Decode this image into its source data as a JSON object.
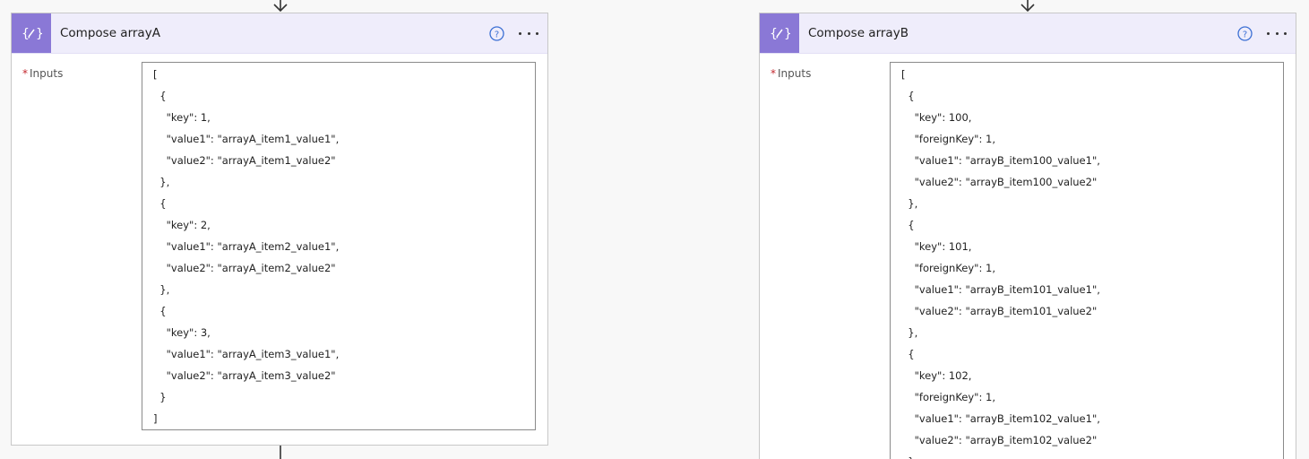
{
  "cardA": {
    "title": "Compose arrayA",
    "icon": "compose-icon",
    "input_label": "Inputs",
    "required_marker": "*",
    "lines": [
      "[",
      "  {",
      "    \"key\": 1,",
      "    \"value1\": \"arrayA_item1_value1\",",
      "    \"value2\": \"arrayA_item1_value2\"",
      "  },",
      "  {",
      "    \"key\": 2,",
      "    \"value1\": \"arrayA_item2_value1\",",
      "    \"value2\": \"arrayA_item2_value2\"",
      "  },",
      "  {",
      "    \"key\": 3,",
      "    \"value1\": \"arrayA_item3_value1\",",
      "    \"value2\": \"arrayA_item3_value2\"",
      "  }",
      "]"
    ]
  },
  "cardB": {
    "title": "Compose arrayB",
    "icon": "compose-icon",
    "input_label": "Inputs",
    "required_marker": "*",
    "lines": [
      "[",
      "  {",
      "    \"key\": 100,",
      "    \"foreignKey\": 1,",
      "    \"value1\": \"arrayB_item100_value1\",",
      "    \"value2\": \"arrayB_item100_value2\"",
      "  },",
      "  {",
      "    \"key\": 101,",
      "    \"foreignKey\": 1,",
      "    \"value1\": \"arrayB_item101_value1\",",
      "    \"value2\": \"arrayB_item101_value2\"",
      "  },",
      "  {",
      "    \"key\": 102,",
      "    \"foreignKey\": 1,",
      "    \"value1\": \"arrayB_item102_value1\",",
      "    \"value2\": \"arrayB_item102_value2\"",
      "  }"
    ]
  },
  "colors": {
    "header_bg": "#efedfb",
    "icon_bg": "#8a78d6",
    "help_icon": "#3b6fd4",
    "required": "#c4262e"
  }
}
